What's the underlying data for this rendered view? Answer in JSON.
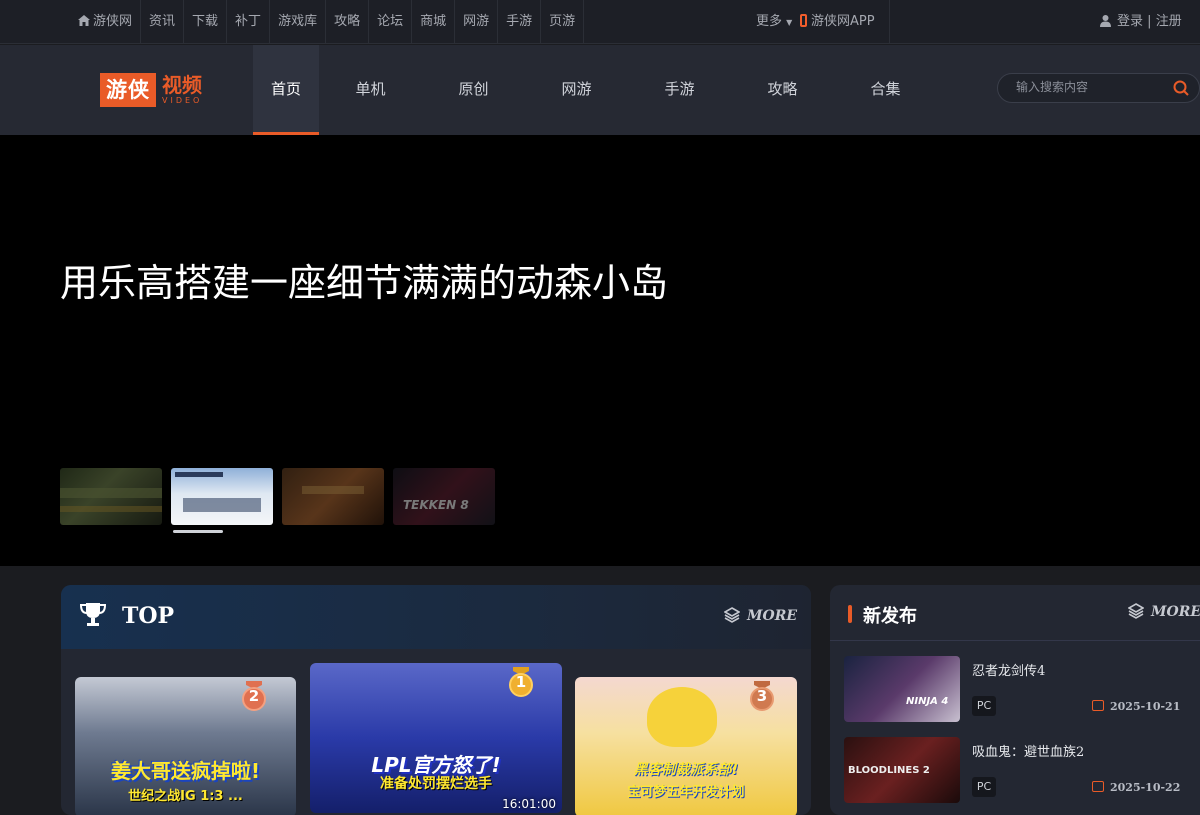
{
  "topbar": {
    "links": [
      "游侠网",
      "资讯",
      "下载",
      "补丁",
      "游戏库",
      "攻略",
      "论坛",
      "商城",
      "网游",
      "手游",
      "页游"
    ],
    "more": "更多",
    "app": "游侠网APP",
    "login": "登录",
    "register": "注册",
    "separator": "|"
  },
  "logo": {
    "brand": "游侠",
    "product": "视频",
    "sub": "VIDEO"
  },
  "nav": {
    "items": [
      "首页",
      "单机",
      "原创",
      "网游",
      "手游",
      "攻略",
      "合集"
    ],
    "active": "首页"
  },
  "search": {
    "placeholder": "输入搜索内容"
  },
  "hero": {
    "title": "用乐高搭建一座细节满满的动森小岛",
    "thumb_label": "TEKKEN 8"
  },
  "top": {
    "title": "TOP",
    "more": "MORE",
    "videos": [
      {
        "rank": "2",
        "caption1": "姜大哥送疯掉啦!",
        "caption2": "世纪之战IG 1:3 ..."
      },
      {
        "rank": "1",
        "caption1": "LPL官方怒了!",
        "caption2": "准备处罚摆烂选手",
        "duration": "16:01:00"
      },
      {
        "rank": "3",
        "caption1": "黑客制裁派系部!",
        "caption2": "宝可梦五年开发计划"
      }
    ]
  },
  "new_release": {
    "title": "新发布",
    "more": "MORE",
    "items": [
      {
        "name": "忍者龙剑传4",
        "tag": "PC",
        "date": "2025-10-21",
        "thumb_text": "NINJA 4"
      },
      {
        "name": "吸血鬼：避世血族2",
        "tag": "PC",
        "date": "2025-10-22",
        "thumb_text": "BLOODLINES 2"
      }
    ]
  },
  "colors": {
    "accent": "#e95b28",
    "background": "#1b1c20",
    "panel": "#232732"
  }
}
